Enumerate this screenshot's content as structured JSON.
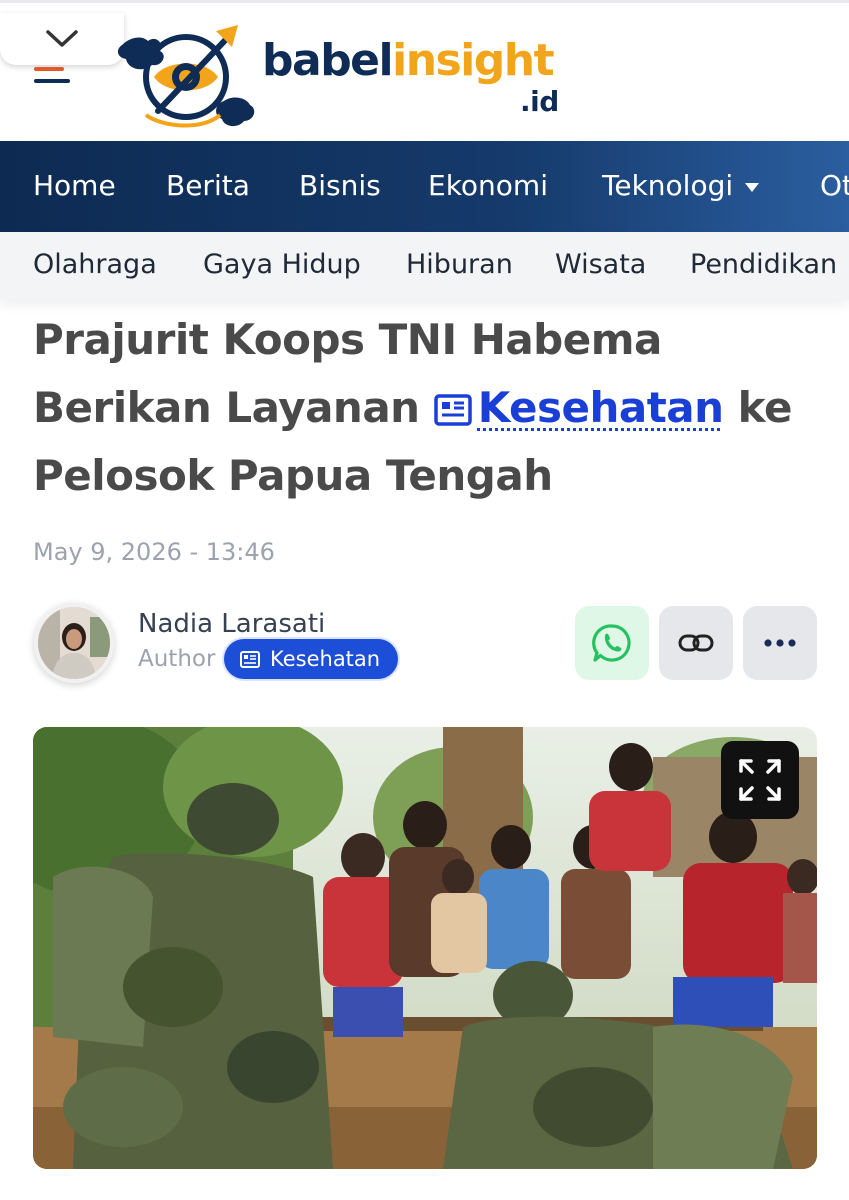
{
  "header": {
    "logo_part1": "babel",
    "logo_part2": "insight",
    "logo_suffix": ".id",
    "collapse_icon": "chevron-down-icon",
    "menu_icon": "hamburger-menu-icon",
    "colors": {
      "brand_navy": "#0f2c56",
      "brand_orange": "#f2a51a",
      "menu_accent": "#e05a2a"
    }
  },
  "nav": {
    "primary": [
      "Home",
      "Berita",
      "Bisnis",
      "Ekonomi",
      "Teknologi",
      "Ot"
    ],
    "secondary": [
      "Olahraga",
      "Gaya Hidup",
      "Hiburan",
      "Wisata",
      "Pendidikan"
    ]
  },
  "article": {
    "title_part1": "Prajurit Koops TNI Habema Berikan Layanan",
    "title_link": "Kesehatan",
    "title_part2": "ke Pelosok Papua Tengah",
    "date": "May 9, 2026 - 13:46",
    "author_name": "Nadia Larasati",
    "author_role": "Author",
    "category": "Kesehatan",
    "link_color": "#1a3fd6",
    "badge_color": "#1d4ed8"
  },
  "share": {
    "whatsapp_icon": "whatsapp-icon",
    "link_icon": "link-icon",
    "more_icon": "more-dots-icon"
  },
  "photo": {
    "expand_icon": "expand-icon"
  }
}
